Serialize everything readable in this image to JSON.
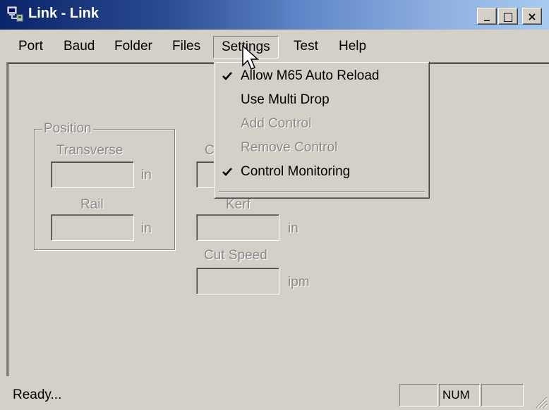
{
  "window": {
    "title": "Link - Link",
    "icon": "computer-link-icon",
    "controls": {
      "minimize": "_",
      "maximize": "□",
      "close": "×"
    }
  },
  "menubar": {
    "items": [
      {
        "label": "Port"
      },
      {
        "label": "Baud"
      },
      {
        "label": "Folder"
      },
      {
        "label": "Files"
      },
      {
        "label": "Settings",
        "open": true
      },
      {
        "label": "Test"
      },
      {
        "label": "Help"
      }
    ]
  },
  "settings_menu": {
    "items": [
      {
        "label": "Allow M65 Auto Reload",
        "checked": true,
        "enabled": true
      },
      {
        "label": "Use Multi Drop",
        "checked": false,
        "enabled": true
      },
      {
        "label": "Add Control",
        "checked": false,
        "enabled": false
      },
      {
        "label": "Remove Control",
        "checked": false,
        "enabled": false
      },
      {
        "label": "Control Monitoring",
        "checked": true,
        "enabled": true
      }
    ]
  },
  "form": {
    "position_group": "Position",
    "transverse_label": "Transverse",
    "transverse_value": "",
    "transverse_unit": "in",
    "rail_label": "Rail",
    "rail_value": "",
    "rail_unit": "in",
    "partial_label_c": "C",
    "field2_value": "",
    "kerf_label": "Kerf",
    "kerf_value": "",
    "kerf_unit": "in",
    "cut_speed_label": "Cut Speed",
    "cut_speed_value": "",
    "cut_speed_unit": "ipm"
  },
  "statusbar": {
    "text": "Ready...",
    "panel1": "",
    "panel2": "NUM",
    "panel3": ""
  },
  "colors": {
    "titlebar_start": "#0a246a",
    "titlebar_end": "#a6caf0",
    "face": "#d4d0c8",
    "disabled_text": "#8a8a8a"
  }
}
